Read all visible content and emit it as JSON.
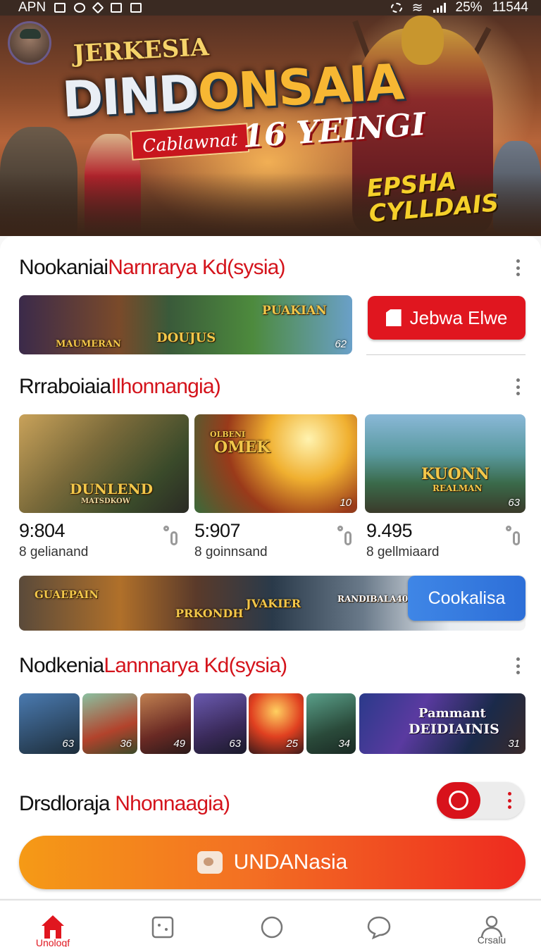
{
  "status_bar": {
    "carrier": "APN",
    "battery": "25%",
    "time": "11544"
  },
  "hero": {
    "kicker": "JERKESIA",
    "title_part1": "DIND",
    "title_part2": "ONSAIA",
    "ribbon": "Cablawnat",
    "subtitle": "16 YEINGI",
    "tagline_line1": "EPSHA",
    "tagline_line2": "CYLLDAIS"
  },
  "section1": {
    "title_black": "Nookaniai",
    "title_red": "Narnrarya Kd(sysia)",
    "banner_labels": [
      "MAUMERAN",
      "DOUJUS",
      "PUAKIAN"
    ],
    "banner_badge": "62",
    "button_label": "Jebwa Elwe"
  },
  "section2": {
    "title_black": "Rrraboiaia",
    "title_red": "Ilhonnangia)",
    "cards": [
      {
        "label": "DUNLEND",
        "caption": "MATSDKOW",
        "badge": "",
        "count": "9:804",
        "sub": "8 gelianand"
      },
      {
        "label": "OMEK",
        "caption": "OLBENI",
        "badge": "10",
        "count": "5:907",
        "sub": "8 goinnsand"
      },
      {
        "label": "KUONN",
        "caption": "REALMAN",
        "badge": "63",
        "count": "9.495",
        "sub": "8 gellmiaard"
      }
    ],
    "promo_labels": [
      "GUAEPAIN",
      "PRKONDH",
      "JVAKIER",
      "RANDIBALA40"
    ],
    "promo_button": "Cookalisa"
  },
  "section3": {
    "title_black": "Nodkenia",
    "title_red": "Lannnarya Kd(sysia)",
    "thumbs": [
      {
        "badge": "63"
      },
      {
        "badge": "36"
      },
      {
        "badge": "49"
      },
      {
        "badge": "63"
      },
      {
        "badge": "25"
      },
      {
        "badge": "34"
      }
    ],
    "wide_thumb_line1": "Pammant",
    "wide_thumb_line2": "DEIDIAINIS",
    "wide_thumb_badge": "31"
  },
  "section4": {
    "title_black": "Drsdloraja ",
    "title_red": "Nhonnaagia)"
  },
  "cta": {
    "label": "UNDANasia"
  },
  "bottom_nav": {
    "home_label": "Unologf",
    "profile_label": "Crsalu"
  },
  "colors": {
    "accent_red": "#e0161f",
    "accent_blue": "#3f86e6",
    "cta_orange": "#f59a16"
  }
}
